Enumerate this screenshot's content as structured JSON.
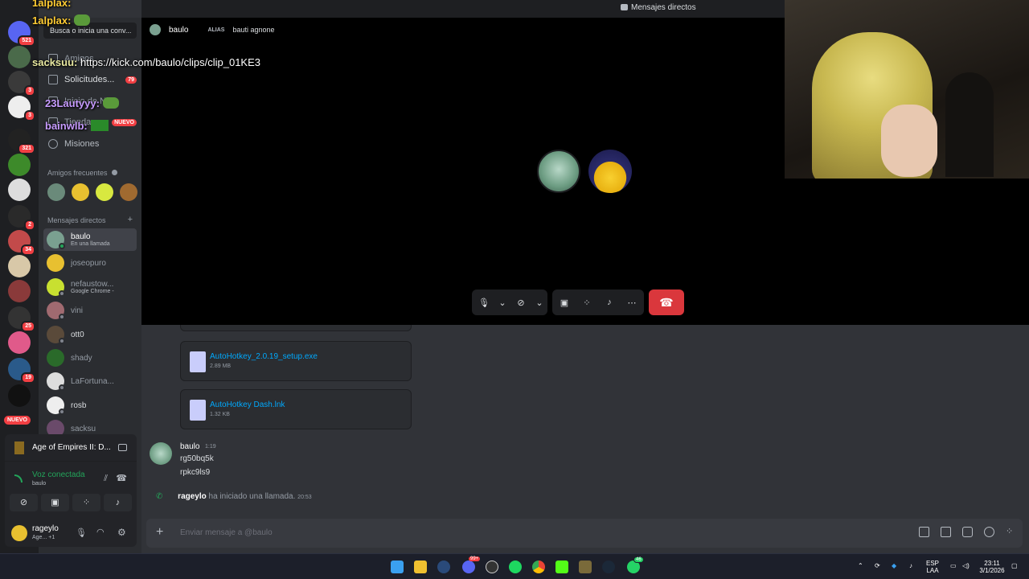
{
  "window": {
    "title": "Mensajes directos"
  },
  "rail": {
    "badges": [
      "521",
      "3",
      "3",
      "321",
      "2",
      "34",
      "25",
      "19"
    ],
    "new_label": "NUEVO"
  },
  "search": {
    "placeholder": "Busca o inicia una conv..."
  },
  "nav": {
    "friends": "Amigos",
    "requests": "Solicitudes...",
    "requests_badge": "79",
    "nitro": "Inicio de Nitro",
    "store": "Tienda",
    "store_badge": "NUEVO",
    "quests": "Misiones"
  },
  "frequent": {
    "title": "Amigos frecuentes"
  },
  "dm_section": {
    "title": "Mensajes directos",
    "add_icon": "plus-icon"
  },
  "dms": [
    {
      "name": "baulo",
      "sub": "En una llamada"
    },
    {
      "name": "joseopuro",
      "sub": ""
    },
    {
      "name": "nefaustow...",
      "sub": "Google Chrome -"
    },
    {
      "name": "vini",
      "sub": ""
    },
    {
      "name": "ott0",
      "sub": ""
    },
    {
      "name": "shady",
      "sub": ""
    },
    {
      "name": "LaFortuna...",
      "sub": ""
    },
    {
      "name": "rosb",
      "sub": ""
    },
    {
      "name": "sacksu",
      "sub": ""
    }
  ],
  "overlay": [
    {
      "user": "1alplax:",
      "text": "",
      "color": "#ffcc33"
    },
    {
      "user": "sacksuu:",
      "text": "https://kick.com/baulo/clips/clip_01KE3",
      "color": "#e8e8a0"
    },
    {
      "user": "23Lautyyy:",
      "text": "",
      "color": "#c79bff"
    },
    {
      "user": "bainwlb:",
      "text": "",
      "color": "#c79bff"
    }
  ],
  "call": {
    "user": "baulo",
    "alias_label": "ALIAS",
    "alias": "bauti agnone"
  },
  "files": [
    {
      "name": "AutoHotkey_2.0.19_setup.exe",
      "size": "2.89 MB"
    },
    {
      "name": "AutoHotkey Dash.lnk",
      "size": "1.32 KB"
    }
  ],
  "message": {
    "author": "baulo",
    "time": "1:19",
    "lines": [
      "rg50bq5k",
      "rpkc9ls9"
    ]
  },
  "system": {
    "user": "rageylo",
    "text": "ha iniciado una llamada.",
    "time": "20:53"
  },
  "composer": {
    "placeholder": "Enviar mensaje a @baulo"
  },
  "activity": {
    "game": "Age of Empires II: D..."
  },
  "voice": {
    "status": "Voz conectada",
    "channel": "baulo"
  },
  "user": {
    "name": "rageylo",
    "status": "Age... +1"
  },
  "taskbar": {
    "lang": "ESP",
    "lang2": "LAA",
    "time": "23:11",
    "date": "3/1/2026",
    "badge_discord": "99+",
    "badge_whatsapp": "46"
  },
  "colors": {
    "accent": "#5865f2",
    "danger": "#da373c",
    "link": "#00a8fc",
    "online": "#23a55a"
  }
}
